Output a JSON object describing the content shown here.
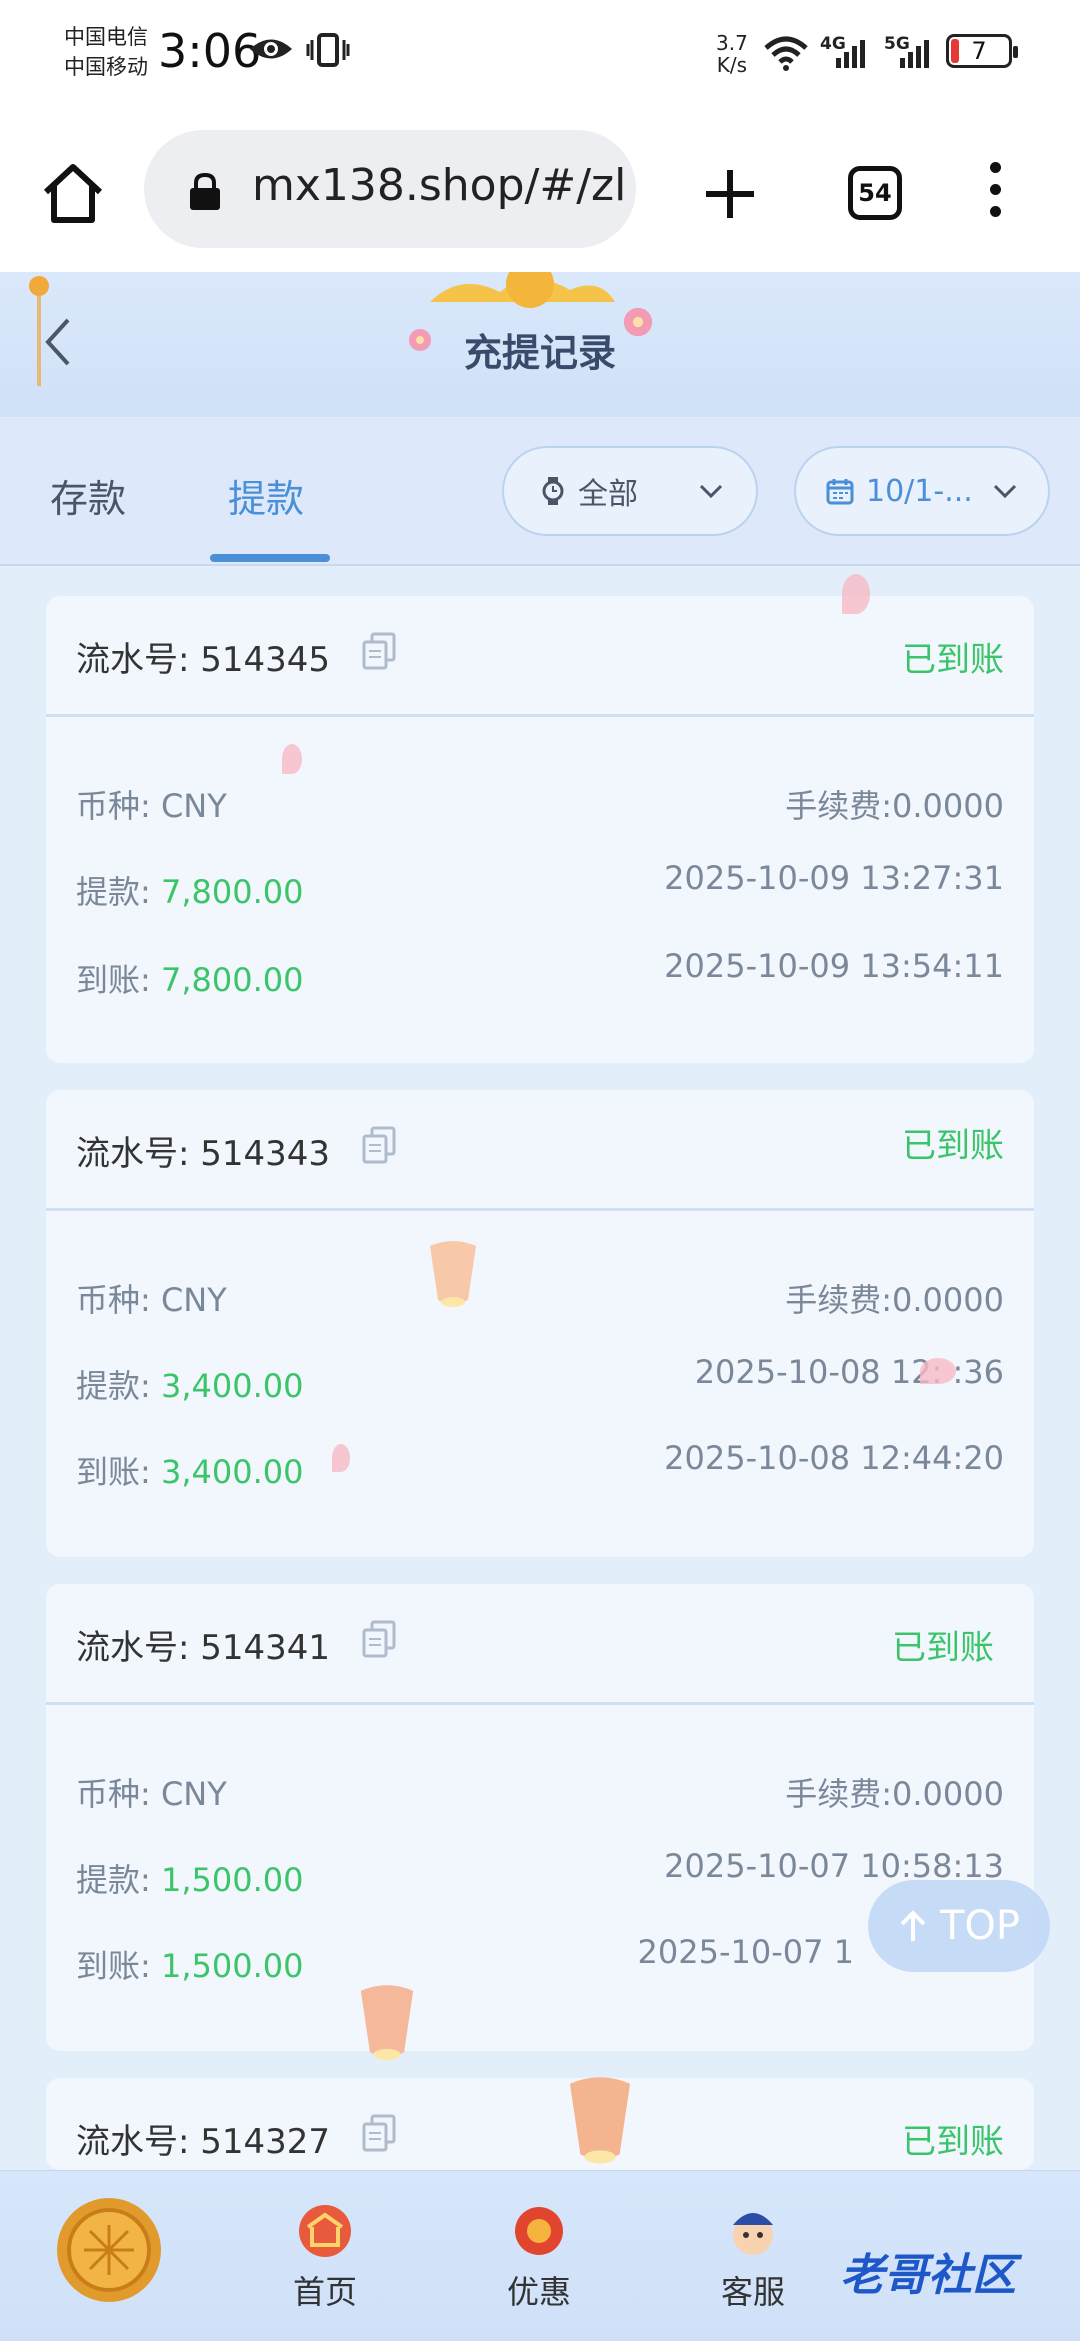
{
  "status_bar": {
    "carrier1": "中国电信",
    "carrier2": "中国移动",
    "time": "3:06",
    "net_speed_value": "3.7",
    "net_speed_unit": "K/s",
    "signal1_label": "4G",
    "signal2_label": "5G",
    "battery": "7"
  },
  "browser": {
    "url": "mx138.shop/#/zl",
    "tab_count": "54"
  },
  "header": {
    "title": "充提记录"
  },
  "tabs": [
    {
      "label": "存款"
    },
    {
      "label": "提款"
    }
  ],
  "filters": {
    "type_label": "全部",
    "date_label": "10/1-..."
  },
  "records": [
    {
      "serial": "流水号: 514345",
      "status": "已到账",
      "currency": "币种: CNY",
      "fee": "手续费:0.0000",
      "withdraw_label": "提款: ",
      "withdraw_amount": "7,800.00",
      "withdraw_time": "2025-10-09 13:27:31",
      "received_label": "到账: ",
      "received_amount": "7,800.00",
      "received_time": "2025-10-09 13:54:11"
    },
    {
      "serial": "流水号: 514343",
      "status": "已到账",
      "currency": "币种: CNY",
      "fee": "手续费:0.0000",
      "withdraw_label": "提款: ",
      "withdraw_amount": "3,400.00",
      "withdraw_time": "2025-10-08 12:  :36",
      "received_label": "到账: ",
      "received_amount": "3,400.00",
      "received_time": "2025-10-08 12:44:20"
    },
    {
      "serial": "流水号: 514341",
      "status": "已到账",
      "currency": "币种: CNY",
      "fee": "手续费:0.0000",
      "withdraw_label": "提款: ",
      "withdraw_amount": "1,500.00",
      "withdraw_time": "2025-10-07 10:58:13",
      "received_label": "到账: ",
      "received_amount": "1,500.00",
      "received_time": "2025-10-07 1"
    },
    {
      "serial": "流水号: 514327",
      "status": "已到账"
    }
  ],
  "top_button": "TOP",
  "bottom_nav": [
    {
      "label": "首页"
    },
    {
      "label": "优惠"
    },
    {
      "label": "客服"
    }
  ],
  "watermark": "老哥社区",
  "colors": {
    "accent": "#4a8fd8",
    "success": "#3cc46a",
    "background": "#e3eefb"
  }
}
